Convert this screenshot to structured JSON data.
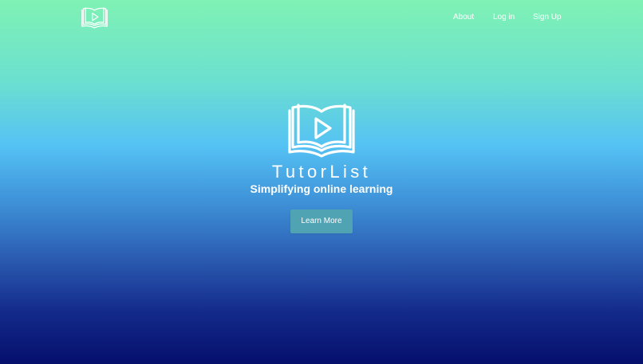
{
  "nav": {
    "logo_icon": "book-play-icon",
    "links": [
      {
        "label": "About"
      },
      {
        "label": "Log in"
      },
      {
        "label": "Sign Up"
      }
    ]
  },
  "hero": {
    "logo_icon": "book-play-icon",
    "title": "TutorList",
    "subtitle": "Simplifying online learning",
    "cta_label": "Learn More"
  },
  "colors": {
    "gradient_top": "#7ff2b4",
    "gradient_middle": "#55c2f4",
    "gradient_bottom": "#050f6c",
    "button_background": "#4fa3b3",
    "text": "#ffffff"
  }
}
